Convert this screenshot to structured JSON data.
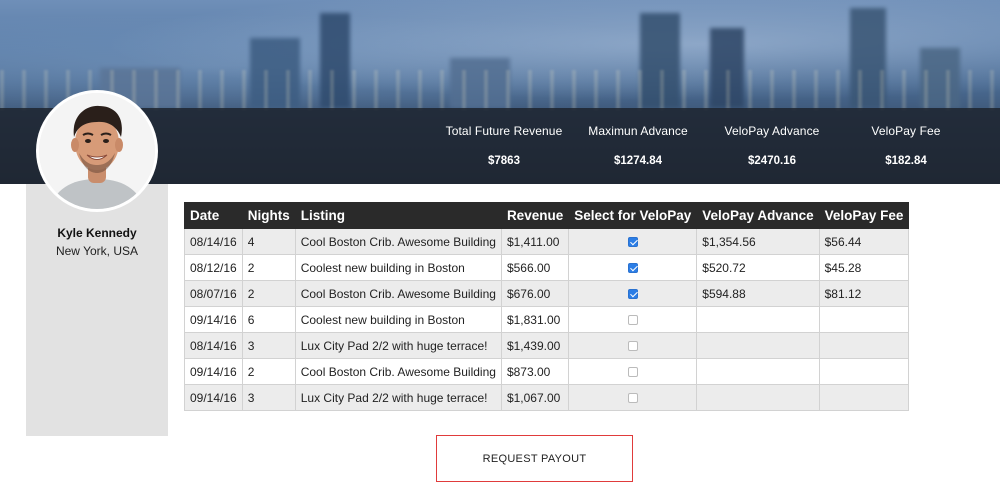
{
  "stats": [
    {
      "label": "Total Future Revenue",
      "value": "$7863"
    },
    {
      "label": "Maximun Advance",
      "value": "$1274.84"
    },
    {
      "label": "VeloPay Advance",
      "value": "$2470.16"
    },
    {
      "label": "VeloPay Fee",
      "value": "$182.84"
    }
  ],
  "profile": {
    "name": "Kyle Kennedy",
    "location": "New York, USA"
  },
  "table": {
    "headers": [
      "Date",
      "Nights",
      "Listing",
      "Revenue",
      "Select for VeloPay",
      "VeloPay Advance",
      "VeloPay Fee"
    ],
    "rows": [
      {
        "date": "08/14/16",
        "nights": "4",
        "listing": "Cool Boston Crib. Awesome Building",
        "revenue": "$1,411.00",
        "selected": true,
        "advance": "$1,354.56",
        "fee": "$56.44"
      },
      {
        "date": "08/12/16",
        "nights": "2",
        "listing": "Coolest new building in Boston",
        "revenue": "$566.00",
        "selected": true,
        "advance": "$520.72",
        "fee": "$45.28"
      },
      {
        "date": "08/07/16",
        "nights": "2",
        "listing": "Cool Boston Crib. Awesome Building",
        "revenue": "$676.00",
        "selected": true,
        "advance": "$594.88",
        "fee": "$81.12"
      },
      {
        "date": "09/14/16",
        "nights": "6",
        "listing": "Coolest new building in Boston",
        "revenue": "$1,831.00",
        "selected": false,
        "advance": "",
        "fee": ""
      },
      {
        "date": "08/14/16",
        "nights": "3",
        "listing": "Lux City Pad 2/2 with huge terrace!",
        "revenue": "$1,439.00",
        "selected": false,
        "advance": "",
        "fee": ""
      },
      {
        "date": "09/14/16",
        "nights": "2",
        "listing": "Cool Boston Crib. Awesome Building",
        "revenue": "$873.00",
        "selected": false,
        "advance": "",
        "fee": ""
      },
      {
        "date": "09/14/16",
        "nights": "3",
        "listing": "Lux City Pad 2/2 with huge terrace!",
        "revenue": "$1,067.00",
        "selected": false,
        "advance": "",
        "fee": ""
      }
    ]
  },
  "actions": {
    "request_payout": "REQUEST PAYOUT"
  },
  "colors": {
    "header_bar": "#1c222c",
    "table_header": "#2a2a2a",
    "checkbox_checked": "#2c7ee6",
    "button_border": "#e03b3b",
    "sidebar": "#e2e2e2"
  }
}
